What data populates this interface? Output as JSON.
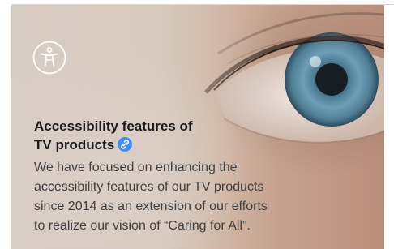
{
  "colors": {
    "accent_link": "#3a8dff",
    "headline": "#1a1a1a",
    "body": "#3f3f3f"
  },
  "icons": {
    "feature_icon": "accessibility-person-icon",
    "link_icon": "link-icon"
  },
  "feature": {
    "title_line1": "Accessibility features of",
    "title_line2": "TV products",
    "description": "We have focused on enhancing the accessibility features of our TV products since 2014 as an extension of our efforts to realize our vision of “Caring for All”."
  }
}
